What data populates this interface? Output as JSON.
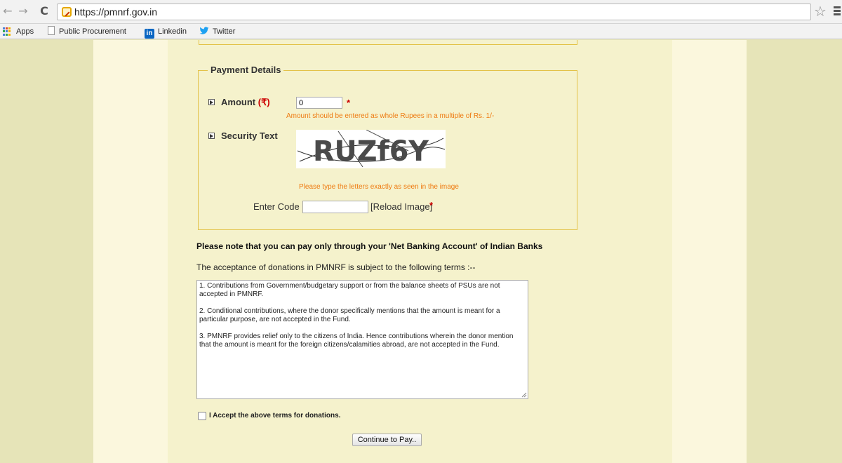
{
  "browser": {
    "url": "https://pmnrf.gov.in",
    "nav": {
      "back": "←",
      "forward": "→",
      "reload": "C"
    },
    "bookmarks": [
      {
        "label": "Apps",
        "icon": "apps-grid-icon"
      },
      {
        "label": "Public Procurement",
        "icon": "page-icon"
      },
      {
        "label": "Linkedin",
        "icon": "linkedin-icon"
      },
      {
        "label": "Twitter",
        "icon": "twitter-icon"
      }
    ],
    "star": "☆"
  },
  "payment": {
    "legend": "Payment Details",
    "amount_label": "Amount",
    "amount_currency": "(₹)",
    "amount_value": "0",
    "required_mark": "*",
    "amount_hint": "Amount should be entered as whole Rupees in a multiple of Rs. 1/-",
    "security_label": "Security Text",
    "captcha_text": "RUZf6Y",
    "captcha_hint": "Please type the letters exactly as seen in the image",
    "enter_code_label": "Enter Code :",
    "reload_label": "[Reload Image]"
  },
  "note": "Please note that you can pay only through your 'Net Banking Account' of Indian Banks",
  "terms": {
    "heading": "The acceptance of donations in PMNRF is subject to the following terms :--",
    "items": [
      "1. Contributions from Government/budgetary support or from the balance sheets of PSUs  are not accepted in PMNRF.",
      "2. Conditional contributions, where the donor specifically mentions that the amount is meant for a particular purpose, are  not accepted in the Fund.",
      "3. PMNRF provides relief only to the citizens of India. Hence contributions wherein the donor mention that the amount is meant for the foreign citizens/calamities abroad, are  not accepted in the Fund."
    ],
    "accept_label": "I Accept the above terms for donations.",
    "accept_checked": false
  },
  "continue_label": "Continue to Pay..",
  "colors": {
    "page_bg": "#e6e4b8",
    "content_bg": "#f5f2cc",
    "fieldset_border": "#e3c248",
    "hint_orange": "#ee7a10",
    "required_red": "#cc0000"
  }
}
